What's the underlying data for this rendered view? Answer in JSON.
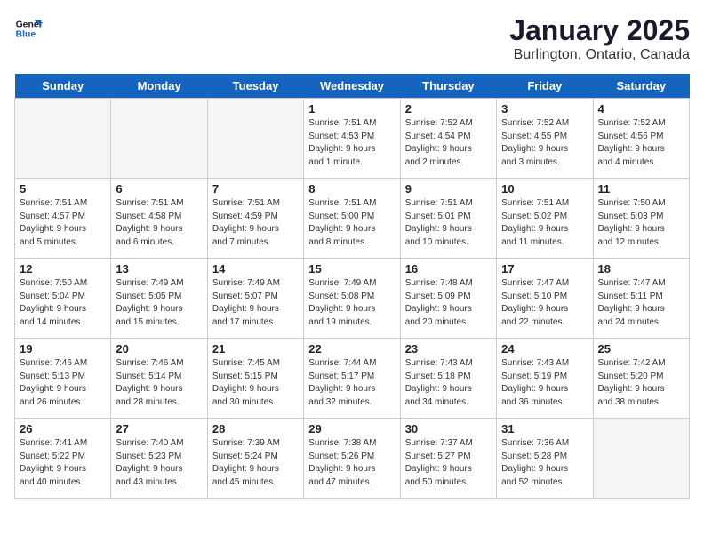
{
  "logo": {
    "line1": "General",
    "line2": "Blue"
  },
  "title": "January 2025",
  "subtitle": "Burlington, Ontario, Canada",
  "days_of_week": [
    "Sunday",
    "Monday",
    "Tuesday",
    "Wednesday",
    "Thursday",
    "Friday",
    "Saturday"
  ],
  "weeks": [
    [
      {
        "num": "",
        "info": "",
        "empty": true
      },
      {
        "num": "",
        "info": "",
        "empty": true
      },
      {
        "num": "",
        "info": "",
        "empty": true
      },
      {
        "num": "1",
        "info": "Sunrise: 7:51 AM\nSunset: 4:53 PM\nDaylight: 9 hours\nand 1 minute.",
        "empty": false
      },
      {
        "num": "2",
        "info": "Sunrise: 7:52 AM\nSunset: 4:54 PM\nDaylight: 9 hours\nand 2 minutes.",
        "empty": false
      },
      {
        "num": "3",
        "info": "Sunrise: 7:52 AM\nSunset: 4:55 PM\nDaylight: 9 hours\nand 3 minutes.",
        "empty": false
      },
      {
        "num": "4",
        "info": "Sunrise: 7:52 AM\nSunset: 4:56 PM\nDaylight: 9 hours\nand 4 minutes.",
        "empty": false
      }
    ],
    [
      {
        "num": "5",
        "info": "Sunrise: 7:51 AM\nSunset: 4:57 PM\nDaylight: 9 hours\nand 5 minutes.",
        "empty": false
      },
      {
        "num": "6",
        "info": "Sunrise: 7:51 AM\nSunset: 4:58 PM\nDaylight: 9 hours\nand 6 minutes.",
        "empty": false
      },
      {
        "num": "7",
        "info": "Sunrise: 7:51 AM\nSunset: 4:59 PM\nDaylight: 9 hours\nand 7 minutes.",
        "empty": false
      },
      {
        "num": "8",
        "info": "Sunrise: 7:51 AM\nSunset: 5:00 PM\nDaylight: 9 hours\nand 8 minutes.",
        "empty": false
      },
      {
        "num": "9",
        "info": "Sunrise: 7:51 AM\nSunset: 5:01 PM\nDaylight: 9 hours\nand 10 minutes.",
        "empty": false
      },
      {
        "num": "10",
        "info": "Sunrise: 7:51 AM\nSunset: 5:02 PM\nDaylight: 9 hours\nand 11 minutes.",
        "empty": false
      },
      {
        "num": "11",
        "info": "Sunrise: 7:50 AM\nSunset: 5:03 PM\nDaylight: 9 hours\nand 12 minutes.",
        "empty": false
      }
    ],
    [
      {
        "num": "12",
        "info": "Sunrise: 7:50 AM\nSunset: 5:04 PM\nDaylight: 9 hours\nand 14 minutes.",
        "empty": false
      },
      {
        "num": "13",
        "info": "Sunrise: 7:49 AM\nSunset: 5:05 PM\nDaylight: 9 hours\nand 15 minutes.",
        "empty": false
      },
      {
        "num": "14",
        "info": "Sunrise: 7:49 AM\nSunset: 5:07 PM\nDaylight: 9 hours\nand 17 minutes.",
        "empty": false
      },
      {
        "num": "15",
        "info": "Sunrise: 7:49 AM\nSunset: 5:08 PM\nDaylight: 9 hours\nand 19 minutes.",
        "empty": false
      },
      {
        "num": "16",
        "info": "Sunrise: 7:48 AM\nSunset: 5:09 PM\nDaylight: 9 hours\nand 20 minutes.",
        "empty": false
      },
      {
        "num": "17",
        "info": "Sunrise: 7:47 AM\nSunset: 5:10 PM\nDaylight: 9 hours\nand 22 minutes.",
        "empty": false
      },
      {
        "num": "18",
        "info": "Sunrise: 7:47 AM\nSunset: 5:11 PM\nDaylight: 9 hours\nand 24 minutes.",
        "empty": false
      }
    ],
    [
      {
        "num": "19",
        "info": "Sunrise: 7:46 AM\nSunset: 5:13 PM\nDaylight: 9 hours\nand 26 minutes.",
        "empty": false
      },
      {
        "num": "20",
        "info": "Sunrise: 7:46 AM\nSunset: 5:14 PM\nDaylight: 9 hours\nand 28 minutes.",
        "empty": false
      },
      {
        "num": "21",
        "info": "Sunrise: 7:45 AM\nSunset: 5:15 PM\nDaylight: 9 hours\nand 30 minutes.",
        "empty": false
      },
      {
        "num": "22",
        "info": "Sunrise: 7:44 AM\nSunset: 5:17 PM\nDaylight: 9 hours\nand 32 minutes.",
        "empty": false
      },
      {
        "num": "23",
        "info": "Sunrise: 7:43 AM\nSunset: 5:18 PM\nDaylight: 9 hours\nand 34 minutes.",
        "empty": false
      },
      {
        "num": "24",
        "info": "Sunrise: 7:43 AM\nSunset: 5:19 PM\nDaylight: 9 hours\nand 36 minutes.",
        "empty": false
      },
      {
        "num": "25",
        "info": "Sunrise: 7:42 AM\nSunset: 5:20 PM\nDaylight: 9 hours\nand 38 minutes.",
        "empty": false
      }
    ],
    [
      {
        "num": "26",
        "info": "Sunrise: 7:41 AM\nSunset: 5:22 PM\nDaylight: 9 hours\nand 40 minutes.",
        "empty": false
      },
      {
        "num": "27",
        "info": "Sunrise: 7:40 AM\nSunset: 5:23 PM\nDaylight: 9 hours\nand 43 minutes.",
        "empty": false
      },
      {
        "num": "28",
        "info": "Sunrise: 7:39 AM\nSunset: 5:24 PM\nDaylight: 9 hours\nand 45 minutes.",
        "empty": false
      },
      {
        "num": "29",
        "info": "Sunrise: 7:38 AM\nSunset: 5:26 PM\nDaylight: 9 hours\nand 47 minutes.",
        "empty": false
      },
      {
        "num": "30",
        "info": "Sunrise: 7:37 AM\nSunset: 5:27 PM\nDaylight: 9 hours\nand 50 minutes.",
        "empty": false
      },
      {
        "num": "31",
        "info": "Sunrise: 7:36 AM\nSunset: 5:28 PM\nDaylight: 9 hours\nand 52 minutes.",
        "empty": false
      },
      {
        "num": "",
        "info": "",
        "empty": true
      }
    ]
  ]
}
